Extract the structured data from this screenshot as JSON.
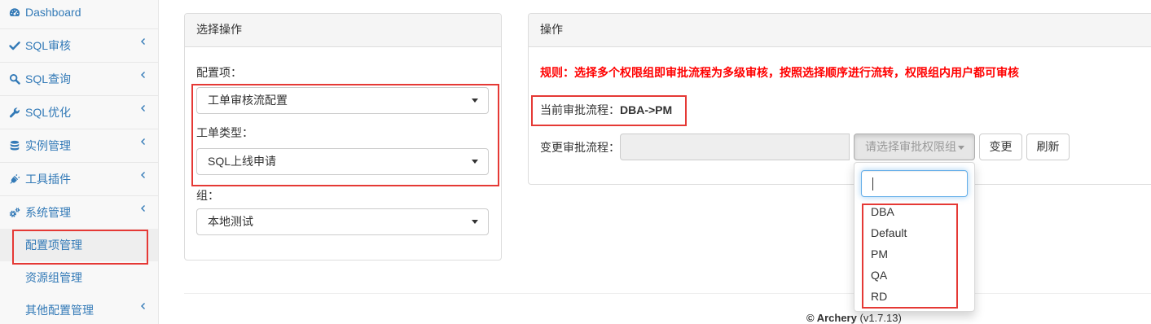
{
  "sidebar": {
    "items": [
      {
        "label": "Dashboard",
        "icon": "dashboard-icon"
      },
      {
        "label": "SQL审核",
        "icon": "check-icon"
      },
      {
        "label": "SQL查询",
        "icon": "search-icon"
      },
      {
        "label": "SQL优化",
        "icon": "wrench-icon"
      },
      {
        "label": "实例管理",
        "icon": "database-icon"
      },
      {
        "label": "工具插件",
        "icon": "plug-icon"
      },
      {
        "label": "系统管理",
        "icon": "cogs-icon",
        "expanded": true
      }
    ],
    "sub_items": [
      {
        "label": "配置项管理",
        "active": true
      },
      {
        "label": "资源组管理"
      },
      {
        "label": "其他配置管理",
        "has_children": true
      }
    ]
  },
  "select_panel": {
    "title": "选择操作",
    "fields": [
      {
        "label": "配置项：",
        "value": "工单审核流配置"
      },
      {
        "label": "工单类型：",
        "value": "SQL上线申请"
      },
      {
        "label": "组：",
        "value": "本地测试"
      }
    ]
  },
  "action_panel": {
    "title": "操作",
    "rule_text": "规则：选择多个权限组即审批流程为多级审核，按照选择顺序进行流转，权限组内用户都可审核",
    "current_flow": {
      "label": "当前审批流程：",
      "value": "DBA->PM"
    },
    "change_flow": {
      "label": "变更审批流程：",
      "group_picker_placeholder": "请选择审批权限组",
      "change_button": "变更",
      "refresh_button": "刷新",
      "dropdown_open": true,
      "options": [
        "DBA",
        "Default",
        "PM",
        "QA",
        "RD"
      ]
    }
  },
  "footer": {
    "brand": "© Archery",
    "version": "(v1.7.13)"
  },
  "colors": {
    "link": "#337ab7",
    "sidebar_bg": "#f8f8f8",
    "active_item_bg": "#eeeeee",
    "panel_heading_bg": "#f5f5f5",
    "border": "#dddddd",
    "rule_text": "#ff0000",
    "annotation_highlight": "#e53935",
    "focus_border": "#66afe9"
  }
}
